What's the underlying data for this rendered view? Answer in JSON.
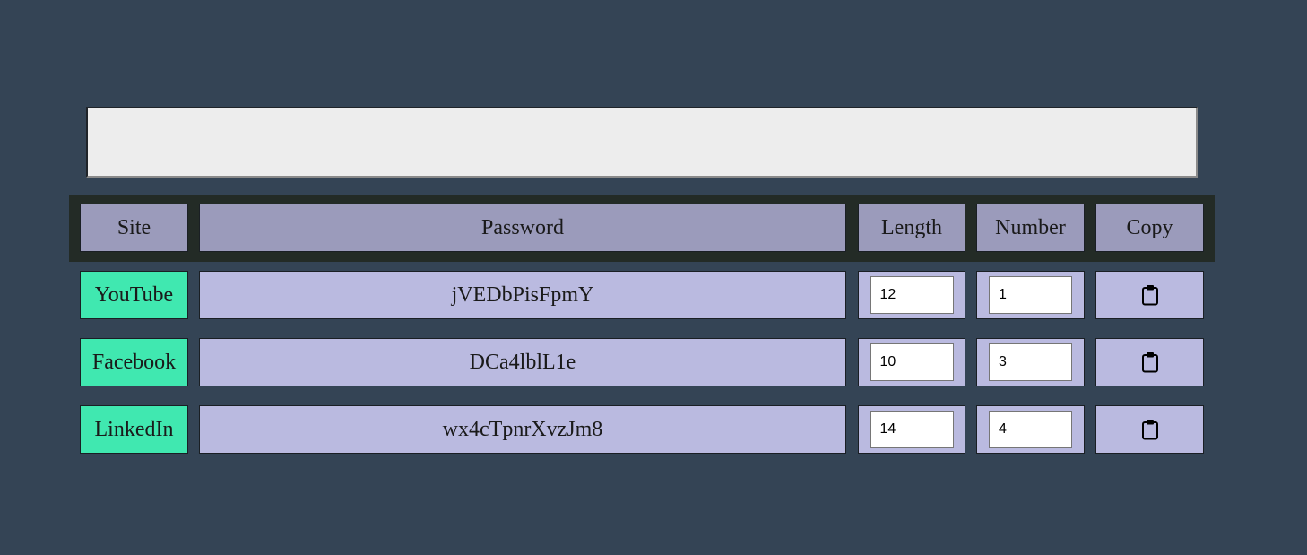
{
  "top_input": {
    "value": "",
    "placeholder": ""
  },
  "table": {
    "headers": {
      "site": "Site",
      "password": "Password",
      "length": "Length",
      "number": "Number",
      "copy": "Copy"
    },
    "rows": [
      {
        "site": "YouTube",
        "password": "jVEDbPisFpmY",
        "length": "12",
        "number": "1",
        "copy_icon": "clipboard-icon"
      },
      {
        "site": "Facebook",
        "password": "DCa4lblL1e",
        "length": "10",
        "number": "3",
        "copy_icon": "clipboard-icon"
      },
      {
        "site": "LinkedIn",
        "password": "wx4cTpnrXvzJm8",
        "length": "14",
        "number": "4",
        "copy_icon": "clipboard-icon"
      }
    ]
  },
  "colors": {
    "background": "#344455",
    "header_band": "#232b26",
    "header_cell": "#9b9bbb",
    "row_cell": "#babae0",
    "site_cell": "#40e8b0",
    "input_bg": "#ededed"
  }
}
